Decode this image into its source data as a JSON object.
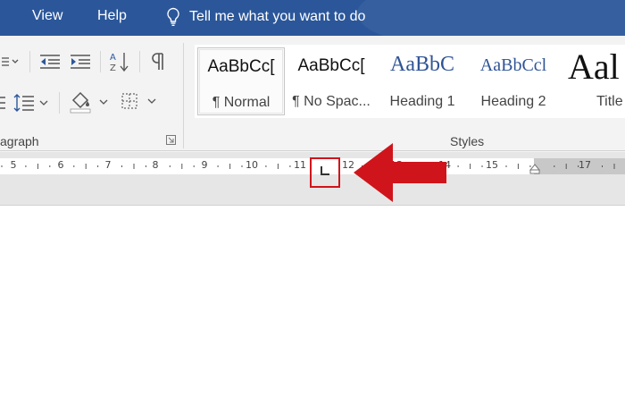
{
  "menu": {
    "view": "View",
    "help": "Help",
    "tell_me": "Tell me what you want to do"
  },
  "ribbon": {
    "paragraph_label": "agraph",
    "styles_label": "Styles",
    "styles": [
      {
        "preview": "AaBbCc[",
        "name": "¶ Normal",
        "selected": true
      },
      {
        "preview": "AaBbCc[",
        "name": "¶ No Spac..."
      },
      {
        "preview": "AaBbC",
        "name": "Heading 1"
      },
      {
        "preview": "AaBbCcl",
        "name": "Heading 2"
      },
      {
        "preview": "Aal",
        "name": "Title"
      }
    ]
  },
  "ruler": {
    "numbers": [
      "5",
      "6",
      "7",
      "8",
      "9",
      "10",
      "11",
      "12",
      "13",
      "14",
      "15",
      "17"
    ]
  },
  "colors": {
    "title_bar": "#2b579a",
    "heading_blue": "#2f5496",
    "highlight_red": "#d0141b"
  }
}
